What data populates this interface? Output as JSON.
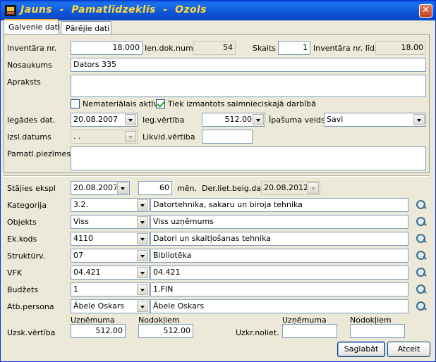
{
  "window": {
    "title": "Jauns  -  Pamatlīdzeklis  -  Ozols",
    "close_glyph": "✕"
  },
  "tabs": [
    {
      "label": "Galvenie dati"
    },
    {
      "label": "Pārējie dati"
    }
  ],
  "main": {
    "inv_nr_label": "Inventāra nr.",
    "inv_nr_value": "18.000",
    "ien_dok_label": "Ien.dok.num.",
    "ien_dok_value": "54",
    "skaits_label": "Skaits",
    "skaits_value": "1",
    "inv_lidz_label": "Inventāra nr. līdz",
    "inv_lidz_value": "18.00",
    "nosaukums_label": "Nosaukums",
    "nosaukums_value": "Dators 335",
    "apraksts_label": "Apraksts",
    "apraksts_value": "",
    "nemat_label": "Nemateriālais aktīvs",
    "nemat_checked": false,
    "tiek_label": "Tiek izmantots saimnieciskajā darbībā",
    "tiek_checked": true,
    "iegades_dat_label": "Iegādes dat.",
    "iegades_dat_value": "20.08.2007",
    "ieg_vertiba_label": "Ieg.vērtība",
    "ieg_vertiba_value": "512.00",
    "ipasuma_label": "Īpašuma veids",
    "ipasuma_value": "Savi",
    "izsl_label": "Izsl.datums",
    "izsl_value": " .  .",
    "likvid_label": "Likvid.vērtiba",
    "likvid_value": "",
    "piezimes_label": "Pamatl.piezīmes",
    "piezimes_value": ""
  },
  "lower": {
    "stajies_label": "Stājies ekspl",
    "stajies_value": "20.08.2007",
    "men_value": "60",
    "men_label": "mēn.",
    "der_label": "Der.liet.beig.dat.",
    "der_value": "20.08.2012",
    "rows": [
      {
        "label": "Kategorija",
        "code": "3.2.",
        "desc": "Datortehnika, sakaru un biroja tehnika"
      },
      {
        "label": "Objekts",
        "code": "Viss",
        "desc": "Viss uzņēmums"
      },
      {
        "label": "Ek.kods",
        "code": "4110",
        "desc": "Datori un skaitļošanas tehnika"
      },
      {
        "label": "Struktūrv.",
        "code": "07",
        "desc": "Bibliotēka"
      },
      {
        "label": "VFK",
        "code": "04.421",
        "desc": "04.421"
      },
      {
        "label": "Budžets",
        "code": "1",
        "desc": "1.FIN"
      },
      {
        "label": "Atb.persona",
        "code": "Ābele Oskars",
        "desc": "Ābele Oskars"
      }
    ],
    "uznemuma_label": "Uzņēmuma",
    "nodokljiem_label": "Nodokļiem",
    "uzsk_label": "Uzsk.vērtība",
    "uzsk_uzn_value": "512.00",
    "uzsk_nod_value": "512.00",
    "uzkr_label": "Uzkr.noliet.",
    "uzkr_uzn_value": "",
    "uzkr_nod_value": ""
  },
  "buttons": {
    "save": "Saglabāt",
    "cancel": "Atcelt"
  }
}
